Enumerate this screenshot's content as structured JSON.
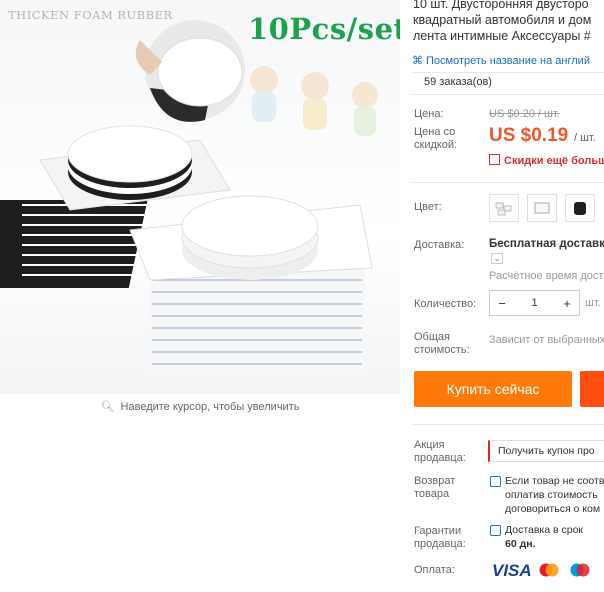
{
  "image": {
    "caption": "THICKEN  FOAM RUBBER",
    "badge": "10Pcs/set",
    "zoom_hint": "Наведите курсор, чтобы увеличить"
  },
  "product": {
    "title_lines": [
      "10 шт. Двусторонняя двусторо",
      "квадратный автомобиля и дом",
      "лента интимные Аксессуары #"
    ],
    "translate_link": "Посмотреть название на англий",
    "orders": "59 заказа(ов)"
  },
  "price": {
    "label": "Цена:",
    "old": "US $0.20 / шт.",
    "discount_label_1": "Цена со",
    "discount_label_2": "скидкой:",
    "current": "US $0.19",
    "unit": "/ шт.",
    "promo": "Скидки ещё больше"
  },
  "color": {
    "label": "Цвет:",
    "swatches": [
      "small-white-pads",
      "square-white-pad",
      "black-roll"
    ]
  },
  "shipping": {
    "label": "Доставка:",
    "value": "Бесплатная доставка",
    "time": "Расчётное время доста"
  },
  "quantity": {
    "label": "Количество:",
    "value": "1",
    "unit": "шт."
  },
  "total": {
    "label_1": "Общая",
    "label_2": "стоимость:",
    "value": "Зависит от выбранных"
  },
  "actions": {
    "buy_now": "Купить сейчас",
    "buy_color": "#ff7a0a",
    "cart_color": "#ff4e0f"
  },
  "seller_promo": {
    "label_1": "Акция",
    "label_2": "продавца:",
    "value": "Получить купон про"
  },
  "returns": {
    "label_1": "Возврат",
    "label_2": "товара",
    "lines": [
      "Если товар не соотв",
      "оплатив стоимость",
      "договориться о ком"
    ]
  },
  "guarantee": {
    "label_1": "Гарантии",
    "label_2": "продавца:",
    "line_1": "Доставка в срок",
    "line_2": "60 дн."
  },
  "payment": {
    "label": "Оплата:",
    "visa": "VISA",
    "methods": [
      "MasterCard",
      "Maestro"
    ]
  }
}
